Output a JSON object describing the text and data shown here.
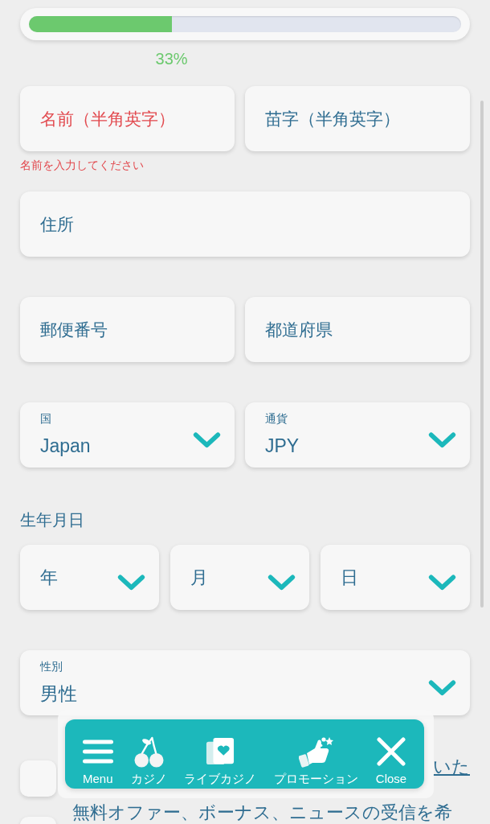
{
  "progress": {
    "level": 0.33,
    "label": "33%"
  },
  "rows": [
    {
      "fields": [
        {
          "kind": "text",
          "placeholder": "名前（半角英字）",
          "invalid": true
        },
        {
          "kind": "text",
          "placeholder": "苗字（半角英字）",
          "invalid": false
        }
      ],
      "error": "名前を入力してください"
    },
    {
      "fields": [
        {
          "kind": "text",
          "placeholder": "住所",
          "invalid": false
        }
      ]
    },
    {
      "fields": [
        {
          "kind": "text",
          "placeholder": "郵便番号",
          "invalid": false
        },
        {
          "kind": "text",
          "placeholder": "都道府県",
          "invalid": false
        }
      ]
    },
    {
      "fields": [
        {
          "kind": "select",
          "label": "国",
          "value": "Japan"
        },
        {
          "kind": "select",
          "label": "通貨",
          "value": "JPY"
        }
      ]
    },
    {
      "heading": "生年月日",
      "fields": [
        {
          "kind": "select",
          "placeholder": "年"
        },
        {
          "kind": "select",
          "placeholder": "月"
        },
        {
          "kind": "select",
          "placeholder": "日"
        }
      ]
    },
    {
      "fields": [
        {
          "kind": "select",
          "label": "性別",
          "value": "男性"
        }
      ]
    }
  ],
  "consents": [
    {
      "checked": false,
      "link": "いた"
    },
    {
      "checked": false,
      "text": "無料オファー、ボーナス、ニュースの受信を希"
    }
  ],
  "bottom_nav": {
    "items": [
      {
        "kind": "menu",
        "label": "Menu"
      },
      {
        "kind": "cherries",
        "label": "カジノ"
      },
      {
        "kind": "cards",
        "label": "ライブカジノ"
      },
      {
        "kind": "thumbs-up",
        "label": "プロモーション"
      },
      {
        "kind": "close",
        "label": "Close"
      }
    ]
  }
}
